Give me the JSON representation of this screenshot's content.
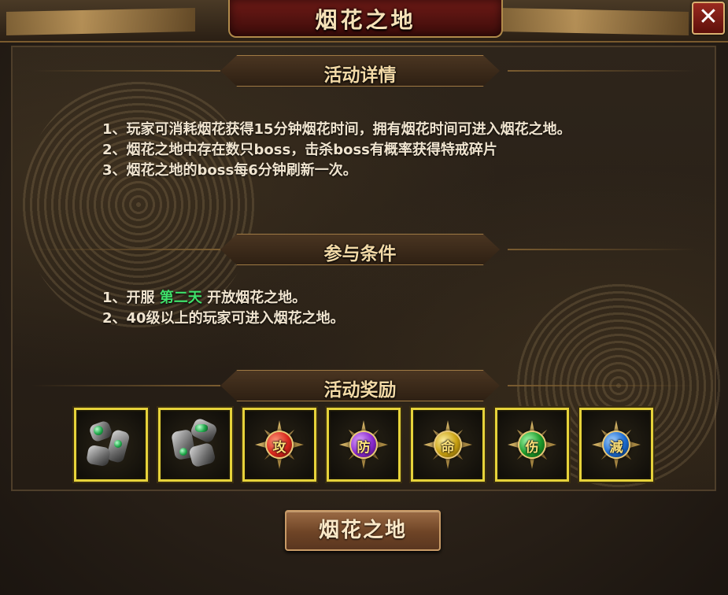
{
  "window": {
    "title": "烟花之地",
    "close_label": "✕"
  },
  "sections": {
    "details": {
      "title": "活动详情",
      "lines": [
        "1、玩家可消耗烟花获得15分钟烟花时间，拥有烟花时间可进入烟花之地。",
        "2、烟花之地中存在数只boss，击杀boss有概率获得特戒碎片",
        "3、烟花之地的boss每6分钟刷新一次。"
      ]
    },
    "conditions": {
      "title": "参与条件",
      "line1_prefix": "1、开服 ",
      "line1_highlight": "第二天",
      "line1_suffix": " 开放烟花之地。",
      "line2": "2、40级以上的玩家可进入烟花之地。"
    },
    "rewards": {
      "title": "活动奖励",
      "items": [
        {
          "icon": "armor-fragment-1-icon"
        },
        {
          "icon": "armor-fragment-2-icon"
        },
        {
          "icon": "attack-emblem-icon",
          "glyph": "攻",
          "color": "#d8261c"
        },
        {
          "icon": "defense-emblem-icon",
          "glyph": "防",
          "color": "#8a2ad0"
        },
        {
          "icon": "life-emblem-icon",
          "glyph": "命",
          "color": "#c8a010"
        },
        {
          "icon": "damage-emblem-icon",
          "glyph": "伤",
          "color": "#1c9a2a"
        },
        {
          "icon": "reduce-emblem-icon",
          "glyph": "減",
          "color": "#1a6ad0"
        }
      ]
    }
  },
  "actions": {
    "enter_label": "烟花之地"
  },
  "colors": {
    "highlight": "#3fe06a",
    "slot_border": "#e6d23a",
    "title_text": "#f6e2b8"
  }
}
